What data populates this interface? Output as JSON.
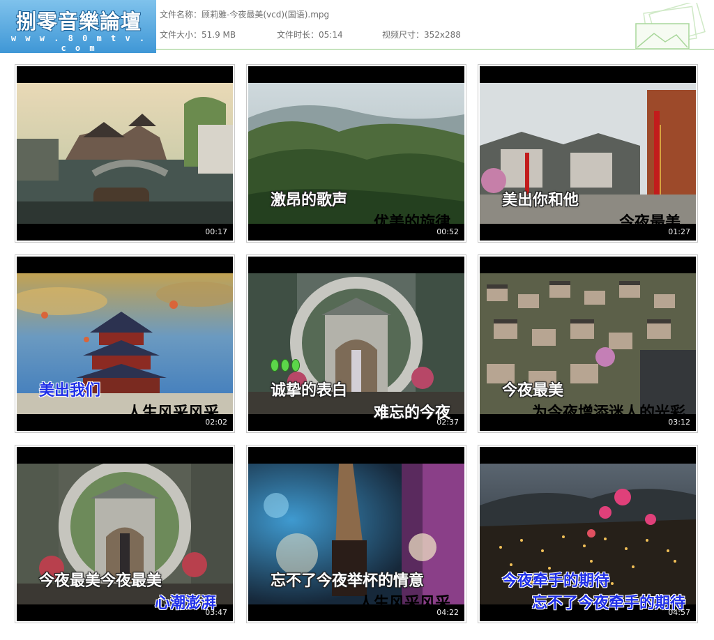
{
  "header": {
    "logo_title": "捌零音樂論壇",
    "logo_url": "w w w . 8 0 m t v . c o m",
    "file_name": "文件名称：顾莉雅-今夜最美(vcd)(国语).mpg",
    "file_size": "文件大小：51.9 MB",
    "duration": "文件时长：05:14",
    "resolution": "视频尺寸：352x288"
  },
  "thumbnails": [
    {
      "time": "00:17",
      "lyric_white": "",
      "lyric_blue_lead": "",
      "lyric_white_tail": ""
    },
    {
      "time": "00:52",
      "lyric_white": "激昂的歌声",
      "lyric_blue_lead": "优美的",
      "lyric_white_tail": "旋律"
    },
    {
      "time": "01:27",
      "lyric_white": "美出你和他",
      "lyric_blue_lead": "今夜最美",
      "lyric_white_tail": ""
    },
    {
      "time": "02:02",
      "lyric_white": "美出我们",
      "lyric_blue_lead": "人生风",
      "lyric_white_tail": "采风采"
    },
    {
      "time": "02:37",
      "lyric_white": "诚挚的表白",
      "lyric_blue_lead": "",
      "lyric_white_tail": "难忘的今夜"
    },
    {
      "time": "03:12",
      "lyric_white": "今夜最美",
      "lyric_blue_lead": "为今夜增添迷",
      "lyric_white_tail": "人的光彩"
    },
    {
      "time": "03:47",
      "lyric_white": "今夜最美今夜最美",
      "lyric_blue_lead": "心潮澎湃",
      "lyric_white_tail": ""
    },
    {
      "time": "04:22",
      "lyric_white": "忘不了今夜举杯的情意",
      "lyric_blue_lead": "人生风采风",
      "lyric_white_tail": "采"
    },
    {
      "time": "04:57",
      "lyric_white": "今夜牵手的期待",
      "lyric_blue_lead": "忘不了今夜牵手的期待",
      "lyric_white_tail": ""
    }
  ]
}
